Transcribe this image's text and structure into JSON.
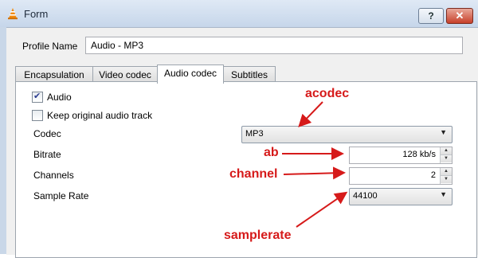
{
  "window": {
    "title": "Form",
    "help_label": "?",
    "close_label": "✕",
    "icon": "vlc-cone-icon"
  },
  "profile": {
    "label": "Profile Name",
    "value": "Audio - MP3"
  },
  "tabs": [
    {
      "label": "Encapsulation",
      "active": false
    },
    {
      "label": "Video codec",
      "active": false
    },
    {
      "label": "Audio codec",
      "active": true
    },
    {
      "label": "Subtitles",
      "active": false
    }
  ],
  "audio_panel": {
    "audio_checkbox": {
      "label": "Audio",
      "checked": true
    },
    "keep_original": {
      "label": "Keep original audio track",
      "checked": false
    },
    "codec": {
      "label": "Codec",
      "value": "MP3"
    },
    "bitrate": {
      "label": "Bitrate",
      "value": "128 kb/s"
    },
    "channels": {
      "label": "Channels",
      "value": "2"
    },
    "samplerate": {
      "label": "Sample Rate",
      "value": "44100"
    }
  },
  "annotations": {
    "color": "#d61a1a",
    "acodec": "acodec",
    "ab": "ab",
    "channel": "channel",
    "samplerate": "samplerate"
  }
}
